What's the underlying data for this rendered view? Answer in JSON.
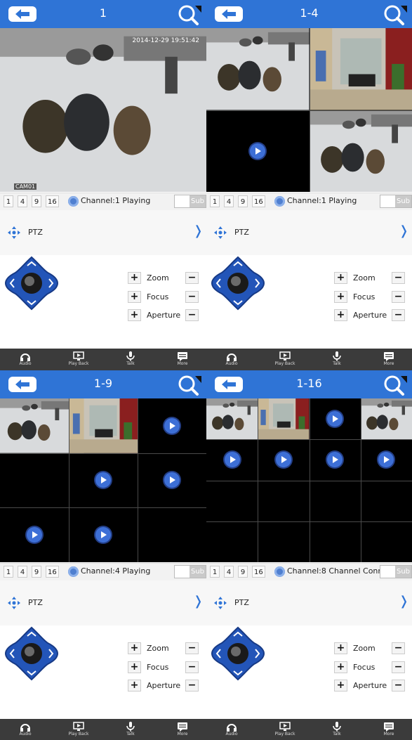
{
  "panels": [
    {
      "title": "1",
      "layout": "1",
      "status": "Channel:1 Playing",
      "timestamp": "2014-12-29 19:51:42",
      "camera_label": "CAM01"
    },
    {
      "title": "1-4",
      "layout": "4",
      "status": "Channel:1 Playing"
    },
    {
      "title": "1-9",
      "layout": "9",
      "status": "Channel:4 Playing"
    },
    {
      "title": "1-16",
      "layout": "16",
      "status": "Channel:8 Channel Conne"
    }
  ],
  "layout_buttons": [
    "1",
    "4",
    "9",
    "16"
  ],
  "sub_label": "Sub",
  "ptz": {
    "label": "PTZ",
    "zoom": "Zoom",
    "focus": "Focus",
    "aperture": "Aperture"
  },
  "bottom": {
    "audio": "Audio",
    "playback": "Play Back",
    "talk": "Talk",
    "more": "More"
  },
  "colors": {
    "accent": "#2f74d6",
    "bottom_bar": "#3b3b3b",
    "play_button": "#3d6fd6"
  }
}
